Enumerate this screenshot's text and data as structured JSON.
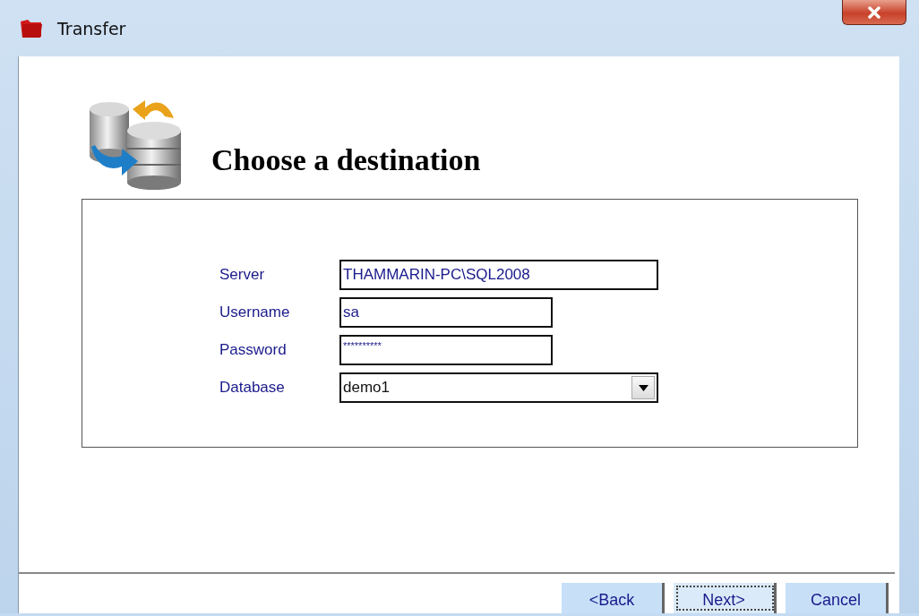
{
  "window": {
    "title": "Transfer"
  },
  "heading": "Choose a destination",
  "fields": [
    {
      "kind": "text",
      "label": "Server",
      "value": "THAMMARIN-PC\\SQL2008",
      "wide": true
    },
    {
      "kind": "text",
      "label": "Username",
      "value": "sa",
      "wide": false
    },
    {
      "kind": "password",
      "label": "Password",
      "value": "**********",
      "wide": false
    },
    {
      "kind": "dropdown",
      "label": "Database",
      "value": "demo1",
      "wide": true
    }
  ],
  "buttons": [
    {
      "label": "<Back",
      "focused": false
    },
    {
      "label": "Next>",
      "focused": true
    },
    {
      "label": "Cancel",
      "focused": false
    }
  ]
}
